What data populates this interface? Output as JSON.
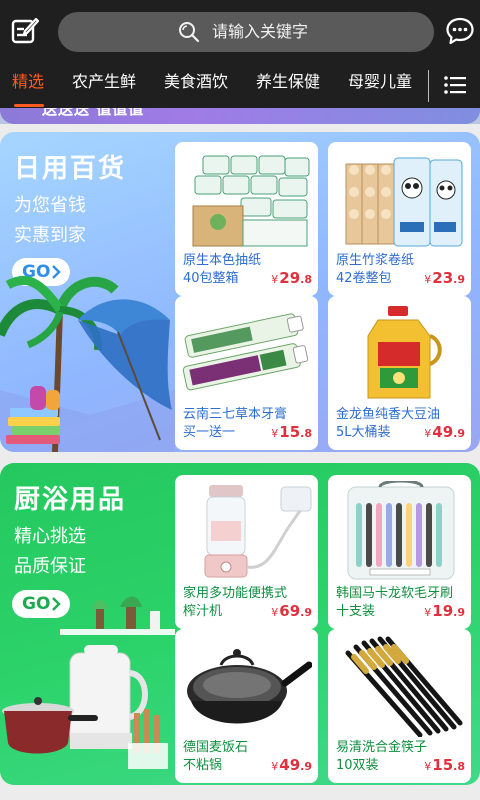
{
  "header": {
    "search_placeholder": "请输入关键字",
    "icons": {
      "left": "edit-icon",
      "search": "search-icon",
      "right": "message-icon",
      "menu": "menu-icon"
    },
    "colors": {
      "background": "#1f1f1f",
      "active_tab": "#ff5a1f"
    }
  },
  "tabs": [
    {
      "label": "精选",
      "active": true
    },
    {
      "label": "农产生鲜",
      "active": false
    },
    {
      "label": "美食酒饮",
      "active": false
    },
    {
      "label": "养生保健",
      "active": false
    },
    {
      "label": "母婴儿童",
      "active": false
    }
  ],
  "prev_banner": {
    "text": "送送送 值值值"
  },
  "sections": [
    {
      "title": "日用百货",
      "lines": [
        "为您省钱",
        "实惠到家"
      ],
      "go_label": "GO",
      "colors": {
        "accent": "#2c6ecf",
        "go_text": "#2f8fe8"
      },
      "products": [
        {
          "name": "原生本色抽纸",
          "sub": "40包整箱",
          "currency": "¥",
          "price_int": "29",
          "price_dec": ".8"
        },
        {
          "name": "原生竹浆卷纸",
          "sub": "42卷整包",
          "currency": "¥",
          "price_int": "23",
          "price_dec": ".9"
        },
        {
          "name": "云南三七草本牙膏",
          "sub": "买一送一",
          "currency": "¥",
          "price_int": "15",
          "price_dec": ".8"
        },
        {
          "name": "金龙鱼纯香大豆油",
          "sub": "5L大桶装",
          "currency": "¥",
          "price_int": "49",
          "price_dec": ".9"
        }
      ]
    },
    {
      "title": "厨浴用品",
      "lines": [
        "精心挑选",
        "品质保证"
      ],
      "go_label": "GO",
      "colors": {
        "accent": "#0f8f3f",
        "go_text": "#1daa4e"
      },
      "products": [
        {
          "name": "家用多功能便携式",
          "sub": "榨汁机",
          "currency": "¥",
          "price_int": "69",
          "price_dec": ".9"
        },
        {
          "name": "韩国马卡龙软毛牙刷",
          "sub": "十支装",
          "currency": "¥",
          "price_int": "19",
          "price_dec": ".9"
        },
        {
          "name": "德国麦饭石",
          "sub": "不粘锅",
          "currency": "¥",
          "price_int": "49",
          "price_dec": ".9"
        },
        {
          "name": "易清洗合金筷子",
          "sub": "10双装",
          "currency": "¥",
          "price_int": "15",
          "price_dec": ".8"
        }
      ]
    }
  ],
  "price_color": "#e0303d"
}
